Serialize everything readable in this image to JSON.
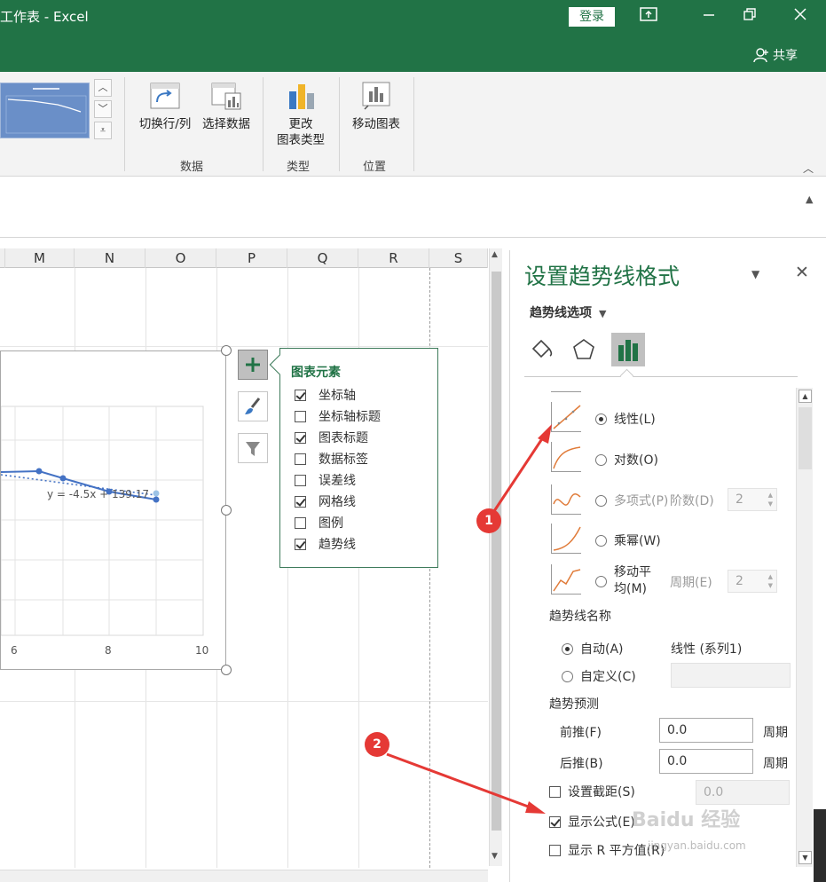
{
  "titlebar": {
    "title": "工作表  -  Excel",
    "login": "登录",
    "share": "共享"
  },
  "ribbon": {
    "buttons": {
      "switch_row_col": "切换行/列",
      "select_data": "选择数据",
      "change_type_1": "更改",
      "change_type_2": "图表类型",
      "move_chart": "移动图表"
    },
    "groups": {
      "data": "数据",
      "type": "类型",
      "location": "位置"
    }
  },
  "sheet": {
    "columns": [
      "M",
      "N",
      "O",
      "P",
      "Q",
      "R",
      "S"
    ]
  },
  "chart": {
    "trendline_equation": "y = -4.5x + 139.17",
    "x_ticks": [
      "6",
      "8",
      "10"
    ]
  },
  "flyout": {
    "title": "图表元素",
    "items": [
      {
        "label": "坐标轴",
        "checked": true
      },
      {
        "label": "坐标轴标题",
        "checked": false
      },
      {
        "label": "图表标题",
        "checked": true
      },
      {
        "label": "数据标签",
        "checked": false
      },
      {
        "label": "误差线",
        "checked": false
      },
      {
        "label": "网格线",
        "checked": true
      },
      {
        "label": "图例",
        "checked": false
      },
      {
        "label": "趋势线",
        "checked": true
      }
    ]
  },
  "pane": {
    "title": "设置趋势线格式",
    "options_label": "趋势线选项",
    "types": {
      "linear": "线性(L)",
      "log": "对数(O)",
      "poly": "多项式(P)",
      "power": "乘幂(W)",
      "moving_1": "移动平",
      "moving_2": "均(M)"
    },
    "order_label": "阶数(D)",
    "order_value": "2",
    "period_label": "周期(E)",
    "period_value": "2",
    "name_section": "趋势线名称",
    "auto_label": "自动(A)",
    "auto_value": "线性 (系列1)",
    "custom_label": "自定义(C)",
    "forecast_section": "趋势预测",
    "forward_label": "前推(F)",
    "forward_value": "0.0",
    "backward_label": "后推(B)",
    "backward_value": "0.0",
    "period_unit": "周期",
    "intercept_label": "设置截距(S)",
    "intercept_value": "0.0",
    "show_equation": "显示公式(E)",
    "show_r2": "显示 R 平方值(R)"
  },
  "annotations": {
    "marker1": "1",
    "marker2": "2",
    "color": "#e53935"
  },
  "watermark": {
    "text": "Baidu 经验",
    "sub": "jingyan.baidu.com"
  }
}
